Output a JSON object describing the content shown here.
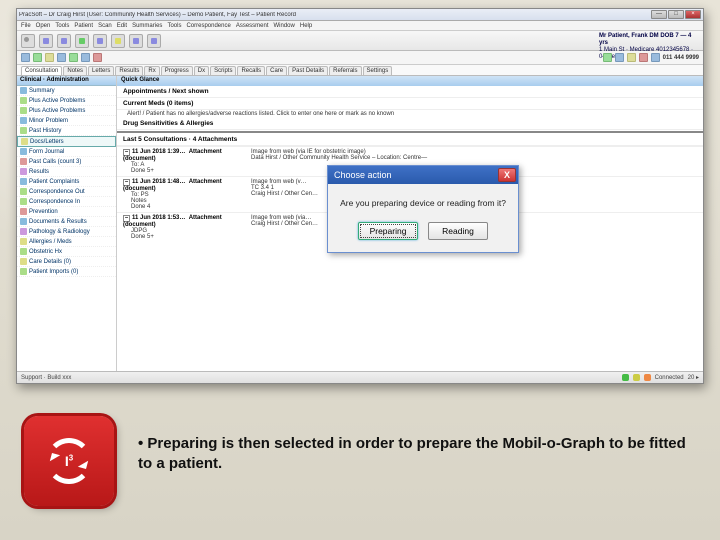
{
  "window": {
    "title": "PracSoft – Dr Craig Hirst (User: Community Health Services) – Demo Patient, Fay Test – Patient Record",
    "min": "—",
    "max": "□",
    "close": "×"
  },
  "menubar": [
    "File",
    "Open",
    "Tools",
    "Patient",
    "Scan",
    "Edit",
    "Summaries",
    "Tools",
    "Correspondence",
    "Assessment",
    "Window",
    "Help"
  ],
  "tabs": [
    "Consultation",
    "Notes",
    "Letters",
    "Results",
    "Rx",
    "Progress",
    "Dx",
    "Scripts",
    "Recalls",
    "Care",
    "Past Details",
    "Referrals",
    "Settings"
  ],
  "patient": {
    "name": "Mr Patient, Frank DM DOB 7 — 4 yrs",
    "sub": "1 Main St · Medicare 4012345678 · 04-Sep"
  },
  "phone": "011 444 9999",
  "sidebar": {
    "header": "Clinical · Administration",
    "items": [
      {
        "label": "Summary"
      },
      {
        "label": "Plus Active Problems"
      },
      {
        "label": "Plus Active Problems"
      },
      {
        "label": "Minor Problem"
      },
      {
        "label": "Past History"
      },
      {
        "label": "Docs/Letters",
        "selected": true
      },
      {
        "label": "Form Journal"
      },
      {
        "label": "Past Calls (count 3)"
      },
      {
        "label": "Results"
      },
      {
        "label": "Patient Complaints"
      },
      {
        "label": "Correspondence Out"
      },
      {
        "label": "Correspondence In"
      },
      {
        "label": "Prevention"
      },
      {
        "label": "Documents & Results"
      },
      {
        "label": "Pathology & Radiology"
      },
      {
        "label": "Allergies / Meds"
      },
      {
        "label": "Obstetric Hx"
      },
      {
        "label": "Care Details (0)"
      },
      {
        "label": "Patient Imports (0)"
      }
    ]
  },
  "main": {
    "quick_header": "Quick Glance",
    "rows": {
      "appts": "Appointments / Next shown",
      "curmed": "Current Meds (0 items)",
      "alert": "Alert! / Patient has no allergies/adverse reactions listed. Click to enter one here or mark as no known",
      "drug": "Drug Sensitivities & Allergies",
      "last_consults": "Last 5 Consultations · 4 Attachments"
    },
    "docs": [
      {
        "date": "11 Jun 2018 1:39…",
        "type": "Attachment (document)",
        "l1": "To: A",
        "l2": "Done 5+",
        "r1": "Image from web (via IE for obstetric image)",
        "r2": "Data Hirst / Other Community Health Service – Location: Centre—"
      },
      {
        "date": "11 Jun 2018 1:48…",
        "type": "Attachment (document)",
        "l1": "To: PS",
        "l2": "Notes",
        "l3": "Done 4",
        "r1": "Image from web (v…",
        "r2": "TC 3.4 1",
        "r3": "Craig Hirst / Other Cen…"
      },
      {
        "date": "11 Jun 2018 1:53…",
        "type": "Attachment (document)",
        "l1": "JDPG",
        "l2": "Done 5+",
        "r1": "Image from web (via…",
        "r2": "Craig Hirst / Other Cen…"
      }
    ]
  },
  "modal": {
    "title": "Choose action",
    "message": "Are you preparing device or reading from it?",
    "btn_prepare": "Preparing",
    "btn_read": "Reading",
    "close": "X"
  },
  "statusbar": {
    "left": "Support · Build xxx",
    "items": [
      "",
      "",
      "Connected",
      "20 ▸"
    ]
  },
  "logo_text": "I³",
  "bullet_text": "• Preparing is then selected in order to prepare the Mobil-o-Graph to be fitted to a patient."
}
